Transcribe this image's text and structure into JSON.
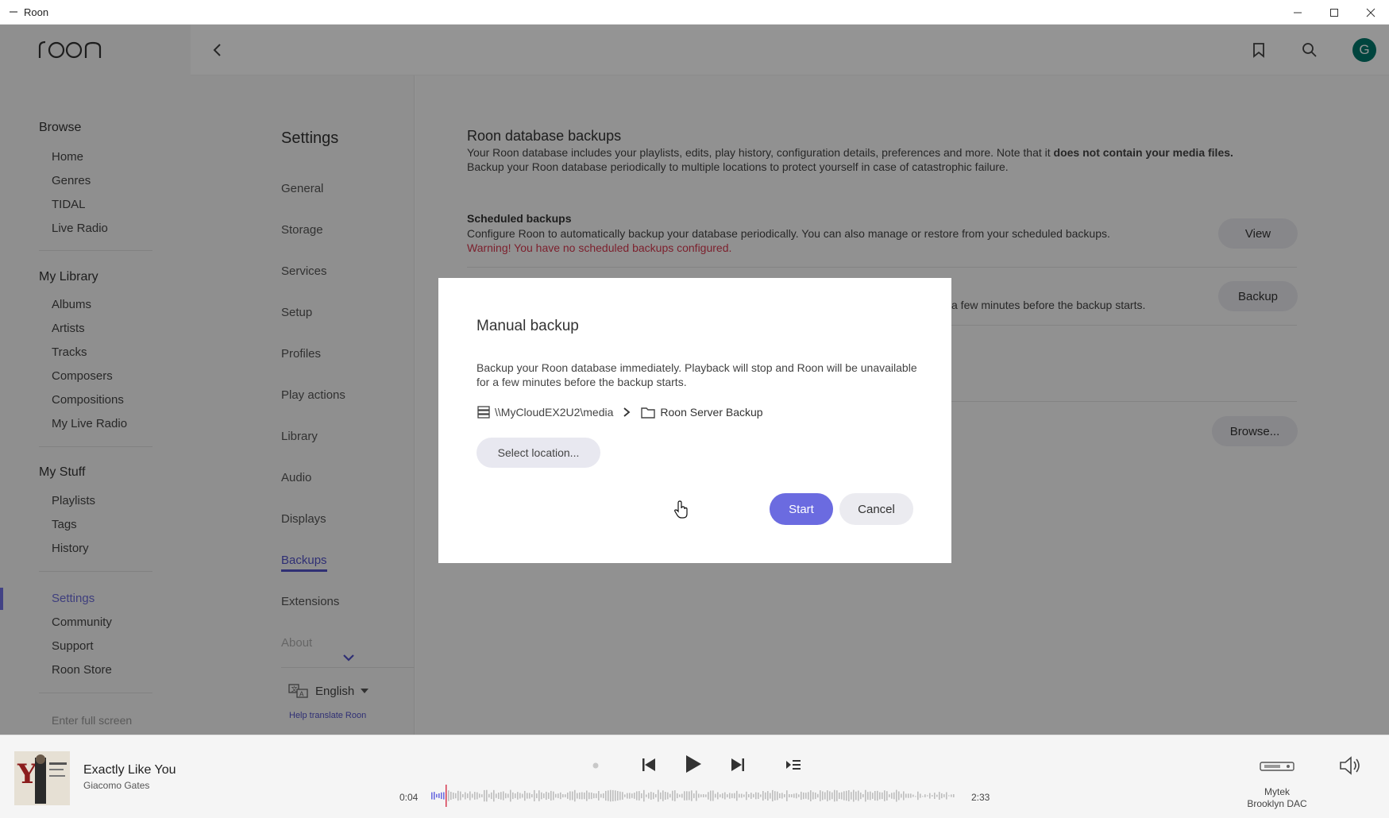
{
  "window": {
    "title": "Roon"
  },
  "nav": {
    "browse_title": "Browse",
    "browse_items": [
      "Home",
      "Genres",
      "TIDAL",
      "Live Radio"
    ],
    "library_title": "My Library",
    "library_items": [
      "Albums",
      "Artists",
      "Tracks",
      "Composers",
      "Compositions",
      "My Live Radio"
    ],
    "stuff_title": "My Stuff",
    "stuff_items": [
      "Playlists",
      "Tags",
      "History"
    ],
    "extra_items": [
      "Settings",
      "Community",
      "Support",
      "Roon Store"
    ],
    "fullscreen": "Enter full screen"
  },
  "topbar": {
    "avatar_letter": "G"
  },
  "settings": {
    "title": "Settings",
    "items": [
      "General",
      "Storage",
      "Services",
      "Setup",
      "Profiles",
      "Play actions",
      "Library",
      "Audio",
      "Displays",
      "Backups",
      "Extensions",
      "About"
    ],
    "active": "Backups",
    "language": "English",
    "help_translate": "Help translate Roon"
  },
  "main": {
    "title": "Roon database backups",
    "desc_part1": "Your Roon database includes your playlists, edits, play history, configuration details, preferences and more. Note that it ",
    "desc_bold": "does not contain your media files.",
    "desc_part2": "Backup your Roon database periodically to multiple locations to protect yourself in case of catastrophic failure.",
    "scheduled_title": "Scheduled backups",
    "scheduled_text": "Configure Roon to automatically backup your database periodically. You can also manage or restore from your scheduled backups.",
    "scheduled_warning": "Warning! You have no scheduled backups configured.",
    "view_button": "View",
    "manual_partial": "a few minutes before the backup starts.",
    "backup_button": "Backup",
    "browse_button": "Browse..."
  },
  "dialog": {
    "title": "Manual backup",
    "desc": "Backup your Roon database immediately. Playback will stop and Roon will be unavailable for a few minutes before the backup starts.",
    "path_root": "\\\\MyCloudEX2U2\\media",
    "path_folder": "Roon Server Backup",
    "select_button": "Select location...",
    "start_button": "Start",
    "cancel_button": "Cancel"
  },
  "player": {
    "track_title": "Exactly Like You",
    "artist": "Giacomo Gates",
    "elapsed": "0:04",
    "duration": "2:33",
    "progress": 0.026,
    "device_line1": "Mytek",
    "device_line2": "Brooklyn DAC"
  },
  "colors": {
    "accent": "#6b6be0",
    "warning": "#d6384f",
    "avatar": "#00776b"
  }
}
